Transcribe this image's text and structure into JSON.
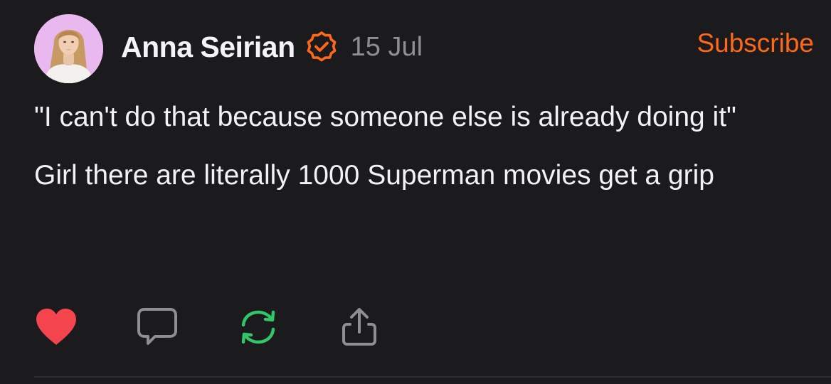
{
  "post": {
    "author_name": "Anna Seirian",
    "date": "15 Jul",
    "subscribe_label": "Subscribe",
    "verified_icon": "verified-badge-icon",
    "paragraphs": [
      "\"I can't do that because someone else is already doing it\"",
      "Girl there are literally 1000 Superman movies get a grip"
    ]
  },
  "actions": {
    "like_icon": "heart-icon",
    "comment_icon": "comment-icon",
    "restack_icon": "restack-icon",
    "share_icon": "share-icon"
  },
  "colors": {
    "background": "#1b1b1d",
    "accent": "#ff6719",
    "like": "#f4444d",
    "restack": "#34c56a",
    "muted": "#8e8e93"
  }
}
